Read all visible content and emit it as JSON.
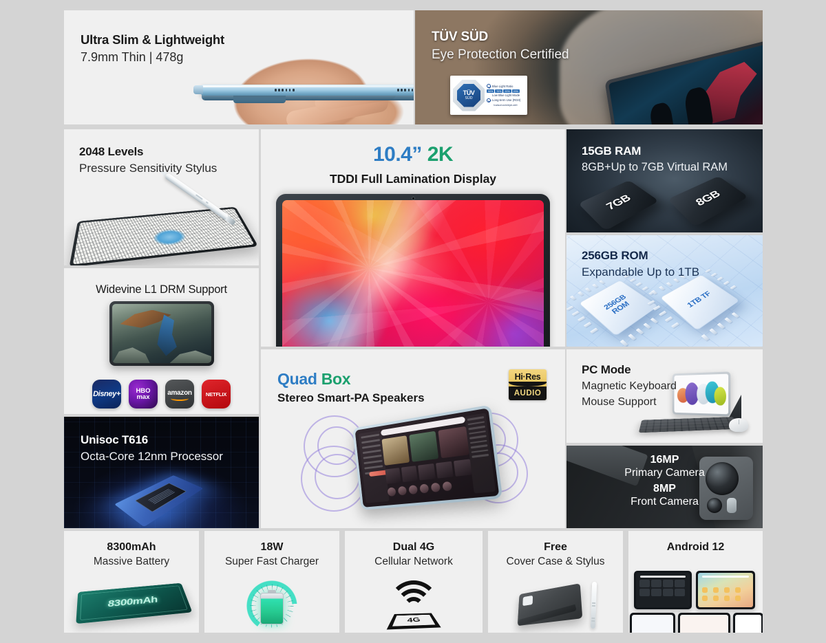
{
  "background_color": "#d4d4d4",
  "panel_color": "#f0f0f0",
  "accent_blue": "#2e7dc4",
  "accent_green": "#1ba06e",
  "panels": {
    "slim": {
      "title": "Ultra Slim & Lightweight",
      "subtitle": "7.9mm Thin | 478g"
    },
    "tuv": {
      "title": "TÜV SÜD",
      "subtitle": "Eye Protection Certified",
      "badge": {
        "mark_top": "TÜV",
        "mark_bottom": "SÜD",
        "line1": "Blue Light Ratio",
        "line2": "Low Blue Light Mode",
        "line3": "Long-term Use (RG0)",
        "bar": [
          "50%",
          "70%",
          "20%",
          "20%"
        ],
        "url": "tuvsud.com/eye-cert"
      }
    },
    "stylus": {
      "title": "2048 Levels",
      "subtitle": "Pressure Sensitivity Stylus"
    },
    "widevine": {
      "title": "Widevine L1 DRM Support",
      "logos": [
        {
          "name": "disney-plus-logo",
          "label": "Disney+"
        },
        {
          "name": "hbo-max-logo",
          "label": "HBO\nmax"
        },
        {
          "name": "amazon-logo",
          "label": "amazon"
        },
        {
          "name": "netflix-logo",
          "label": "NETFLIX"
        }
      ]
    },
    "processor": {
      "title": "Unisoc T616",
      "subtitle": "Octa-Core 12nm Processor"
    },
    "display": {
      "size": "10.4”",
      "resolution": "2K",
      "subtitle": "TDDI Full Lamination Display"
    },
    "ram": {
      "title": "15GB RAM",
      "subtitle": "8GB+Up to 7GB Virtual RAM",
      "chip_left": "7GB",
      "chip_right": "8GB"
    },
    "rom": {
      "title": "256GB ROM",
      "subtitle": "Expandable Up to 1TB",
      "chip_left": "256GB\nROM",
      "chip_right": "1TB TF"
    },
    "audio": {
      "title_a": "Quad",
      "title_b": "Box",
      "subtitle": "Stereo Smart-PA Speakers",
      "badge_top": "Hi·Res",
      "badge_bottom": "AUDIO"
    },
    "pcmode": {
      "title": "PC Mode",
      "line1": "Magnetic Keyboard",
      "line2": "Mouse Support"
    },
    "camera": {
      "primary_mp": "16MP",
      "primary_label": "Primary Camera",
      "front_mp": "8MP",
      "front_label": "Front Camera"
    }
  },
  "bottom_row": [
    {
      "name": "battery",
      "title": "8300mAh",
      "subtitle": "Massive Battery",
      "art_label": "8300mAh"
    },
    {
      "name": "charger",
      "title": "18W",
      "subtitle": "Super Fast Charger",
      "art_label": ""
    },
    {
      "name": "cellular",
      "title": "Dual 4G",
      "subtitle": "Cellular Network",
      "art_label": "4G"
    },
    {
      "name": "accessories",
      "title": "Free",
      "subtitle": "Cover Case & Stylus",
      "art_label": ""
    },
    {
      "name": "os",
      "title": "Android 12",
      "subtitle": "",
      "art_label": ""
    }
  ]
}
